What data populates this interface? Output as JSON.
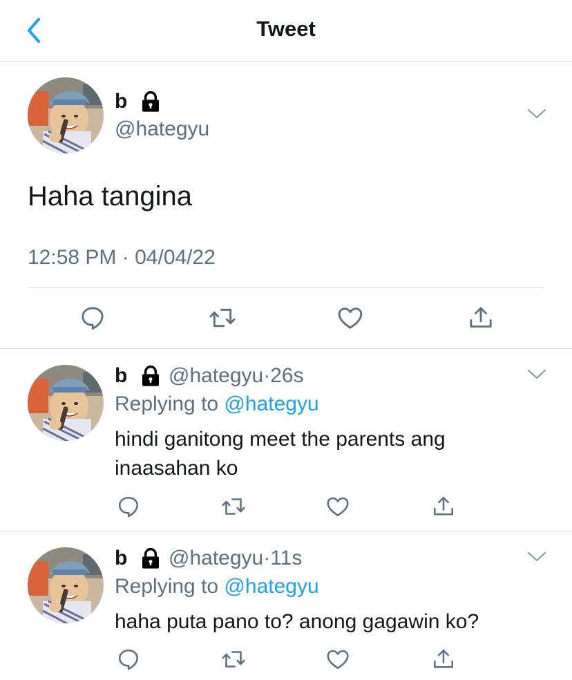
{
  "header": {
    "title": "Tweet"
  },
  "main_tweet": {
    "name": "b",
    "handle": "@hategyu",
    "text": "Haha tangina",
    "time": "12:58 PM",
    "separator": "·",
    "date": "04/04/22"
  },
  "replies": [
    {
      "name": "b",
      "handle": "@hategyu",
      "separator": "·",
      "age": "26s",
      "replying_prefix": "Replying to ",
      "replying_to": "@hategyu",
      "text": "hindi ganitong meet the parents ang inaasahan ko"
    },
    {
      "name": "b",
      "handle": "@hategyu",
      "separator": "·",
      "age": "11s",
      "replying_prefix": "Replying to ",
      "replying_to": "@hategyu",
      "text": "haha puta pano to? anong gagawin ko?"
    }
  ],
  "colors": {
    "accent": "#1da1f2",
    "secondary_text": "#5b7083",
    "divider": "#d6d9dc"
  },
  "icons": [
    "back-chevron-icon",
    "lock-icon",
    "chevron-down-icon",
    "reply-icon",
    "retweet-icon",
    "like-icon",
    "share-icon"
  ]
}
